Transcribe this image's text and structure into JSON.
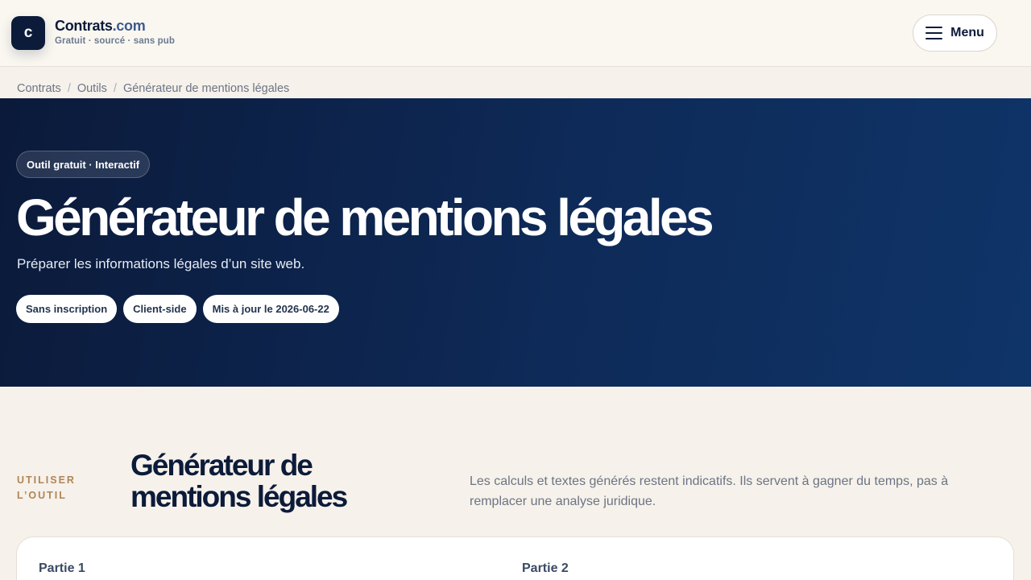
{
  "header": {
    "logo_letter": "c",
    "brand_main": "Contrats",
    "brand_ext": ".com",
    "tagline": "Gratuit · sourcé · sans pub",
    "menu_label": "Menu"
  },
  "breadcrumb": [
    "Contrats",
    "Outils",
    "Générateur de mentions légales"
  ],
  "hero": {
    "badge": "Outil gratuit · Interactif",
    "title": "Générateur de mentions légales",
    "subtitle": "Préparer les informations légales d’un site web.",
    "chips": [
      "Sans inscription",
      "Client-side",
      "Mis à jour le 2026-06-22"
    ]
  },
  "section": {
    "kicker_line1": "UTILISER",
    "kicker_line2": "L’OUTIL",
    "title": "Générateur de mentions légales",
    "description": "Les calculs et textes générés restent indicatifs. Ils servent à gagner du temps, pas à remplacer une analyse juridique."
  },
  "form": {
    "part1_label": "Partie 1",
    "part2_label": "Partie 2"
  },
  "colors": {
    "navy": "#0c1b3a",
    "accent": "#3d5a8a",
    "kicker": "#b08556",
    "page_bg": "#f6f1ea"
  }
}
